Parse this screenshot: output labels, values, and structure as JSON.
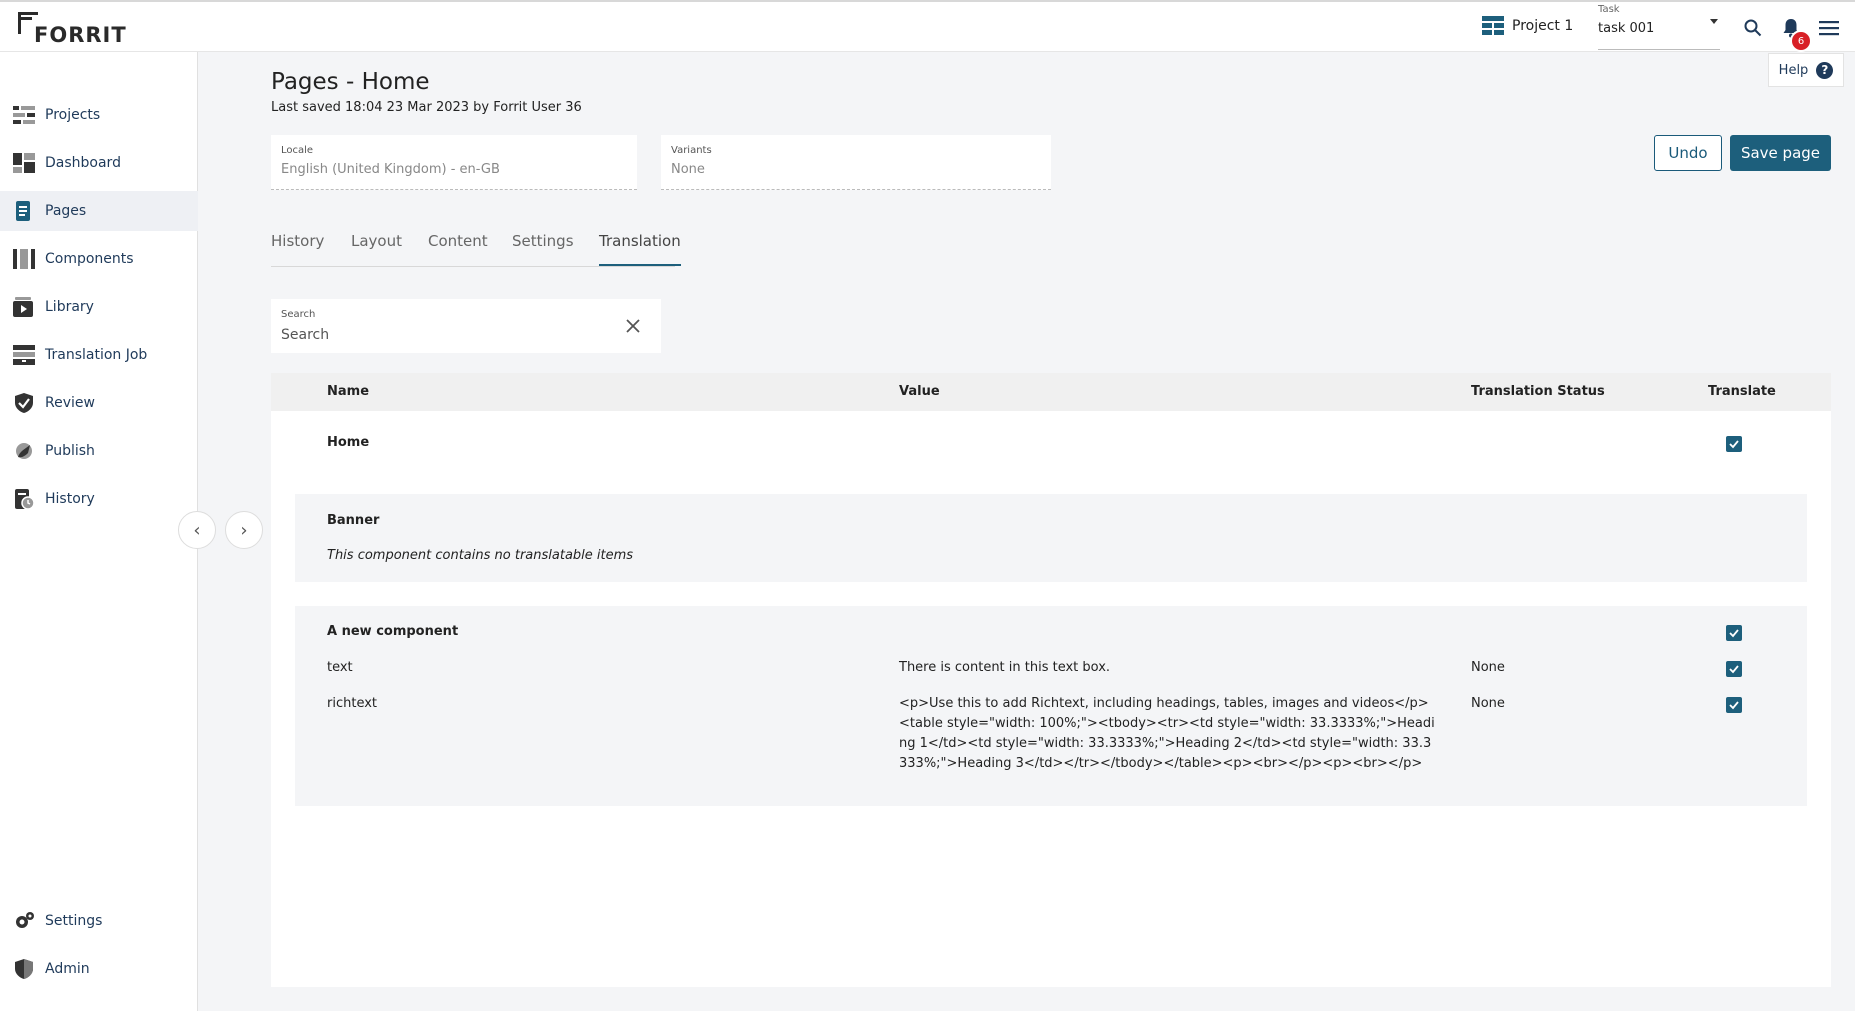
{
  "brand": {
    "name": "FORRIT"
  },
  "topbar": {
    "project": "Project 1",
    "task_label": "Task",
    "task_value": "task 001",
    "notification_count": "6",
    "help_label": "Help",
    "help_icon": "?"
  },
  "sidebar": {
    "items": [
      {
        "label": "Projects",
        "icon": "projects-icon"
      },
      {
        "label": "Dashboard",
        "icon": "dashboard-icon"
      },
      {
        "label": "Pages",
        "icon": "pages-icon",
        "active": true
      },
      {
        "label": "Components",
        "icon": "components-icon"
      },
      {
        "label": "Library",
        "icon": "library-icon"
      },
      {
        "label": "Translation Job",
        "icon": "translation-job-icon"
      },
      {
        "label": "Review",
        "icon": "review-icon"
      },
      {
        "label": "Publish",
        "icon": "publish-icon"
      },
      {
        "label": "History",
        "icon": "history-icon"
      }
    ],
    "bottom": [
      {
        "label": "Settings",
        "icon": "gear-icon"
      },
      {
        "label": "Admin",
        "icon": "admin-icon"
      }
    ]
  },
  "page": {
    "title": "Pages - Home",
    "subtitle": "Last saved 18:04 23 Mar 2023 by Forrit User 36",
    "locale_label": "Locale",
    "locale_value": "English (United Kingdom) - en-GB",
    "variants_label": "Variants",
    "variants_value": "None",
    "undo_label": "Undo",
    "save_label": "Save page"
  },
  "tabs": [
    "History",
    "Layout",
    "Content",
    "Settings",
    "Translation"
  ],
  "active_tab": "Translation",
  "search": {
    "label": "Search",
    "placeholder": "Search"
  },
  "table": {
    "headers": {
      "name": "Name",
      "value": "Value",
      "status": "Translation Status",
      "translate": "Translate"
    },
    "home": {
      "name": "Home",
      "translate": true
    },
    "banner": {
      "name": "Banner",
      "note": "This component contains no translatable items"
    },
    "component": {
      "name": "A new component",
      "translate": true,
      "rows": [
        {
          "name": "text",
          "value": "There is content in this text box.",
          "status": "None",
          "translate": true
        },
        {
          "name": "richtext",
          "value": "<p>Use this to add Richtext, including headings, tables, images and videos</p><table style=\"width: 100%;\"><tbody><tr><td style=\"width: 33.3333%;\">Heading 1</td><td style=\"width: 33.3333%;\">Heading 2</td><td style=\"width: 33.3333%;\">Heading 3</td></tr></tbody></table><p><br></p><p><br></p>",
          "status": "None",
          "translate": true
        }
      ]
    }
  },
  "colors": {
    "accent": "#1d5f7c",
    "badge": "#d81f26",
    "nav_text": "#1f3a5a"
  }
}
